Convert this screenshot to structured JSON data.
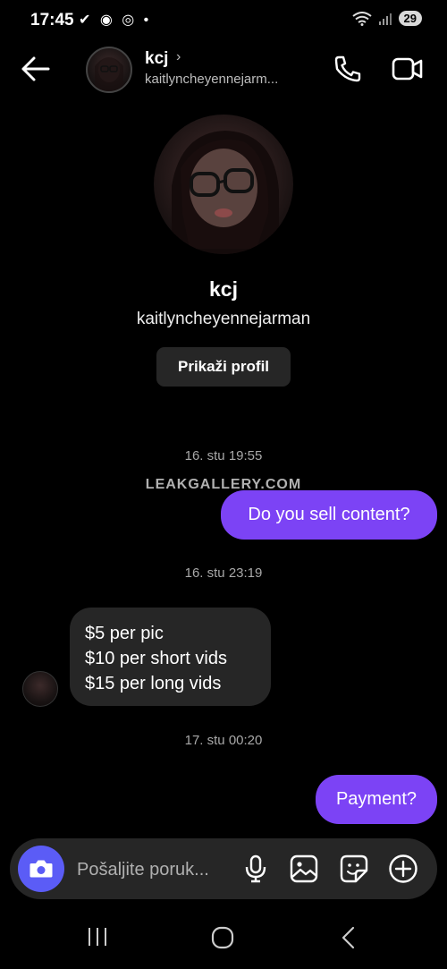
{
  "status_bar": {
    "time": "17:45",
    "icons": "✔ ◉ ◎ •",
    "battery": "29"
  },
  "header": {
    "name": "kcj",
    "chevron": "›",
    "handle": "kaitlyncheyennejarm..."
  },
  "profile": {
    "name": "kcj",
    "handle": "kaitlyncheyennejarman",
    "view_profile_label": "Prikaži profil"
  },
  "messages": {
    "ts1": "16. stu 19:55",
    "watermark": "LEAKGALLERY.COM",
    "m1": "Do you sell content?",
    "ts2": "16. stu 23:19",
    "m2_lines": [
      "$5 per pic",
      "$10 per short vids",
      "$15 per long vids"
    ],
    "ts3": "17. stu 00:20",
    "m3": "Payment?"
  },
  "composer": {
    "placeholder": "Pošaljite poruk..."
  },
  "colors": {
    "accent": "#7c43f5",
    "camera": "#5b5cf6",
    "incoming": "#262626"
  },
  "icons": [
    "back-arrow-icon",
    "phone-icon",
    "video-camera-icon",
    "camera-icon",
    "microphone-icon",
    "image-icon",
    "sticker-icon",
    "plus-circle-icon",
    "recents-icon",
    "home-icon",
    "back-nav-icon"
  ]
}
